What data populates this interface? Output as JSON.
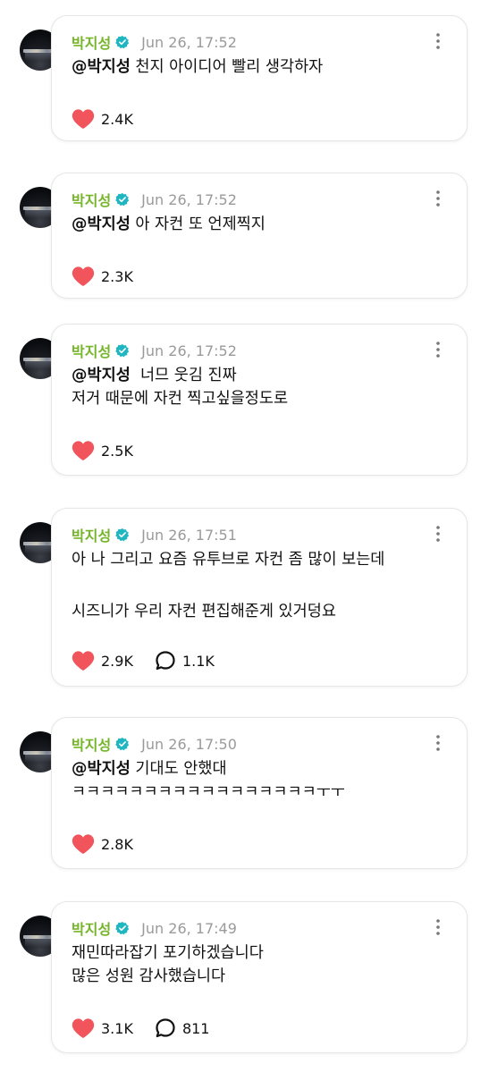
{
  "author": {
    "name": "박지성",
    "verified_icon": "verified-badge-icon",
    "avatar": "night-city-avatar"
  },
  "colors": {
    "name_green": "#76b52b",
    "verified_teal": "#1fb6c1",
    "heart_red": "#f2545b",
    "timestamp_gray": "#9a9a9a"
  },
  "posts": [
    {
      "time": "Jun 26, 17:52",
      "mention": "@박지성",
      "lines": [
        "천지 아이디어 빨리 생각하자"
      ],
      "likes": "2.4K",
      "comments": ""
    },
    {
      "time": "Jun 26, 17:52",
      "mention": "@박지성",
      "lines": [
        "아 자컨 또 언제찍지"
      ],
      "likes": "2.3K",
      "comments": ""
    },
    {
      "time": "Jun 26, 17:52",
      "mention": "@박지성",
      "lines": [
        "너므 웃김 진짜",
        "저거 때문에 자컨 찍고싶을정도로"
      ],
      "likes": "2.5K",
      "comments": ""
    },
    {
      "time": "Jun 26, 17:51",
      "mention": "",
      "lines": [
        "아 나 그리고 요즘 유투브로 자컨 좀 많이 보는데",
        "",
        "시즈니가 우리 자컨 편집해준게 있거덩요"
      ],
      "likes": "2.9K",
      "comments": "1.1K"
    },
    {
      "time": "Jun 26, 17:50",
      "mention": "@박지성",
      "lines": [
        "기대도 안했대",
        "ㅋㅋㅋㅋㅋㅋㅋㅋㅋㅋㅋㅋㅋㅋㅋㅋㅋㅜㅜ"
      ],
      "likes": "2.8K",
      "comments": ""
    },
    {
      "time": "Jun 26, 17:49",
      "mention": "",
      "lines": [
        "재민따라잡기 포기하겠습니다",
        "많은 성원 감사했습니다"
      ],
      "likes": "3.1K",
      "comments": "811"
    }
  ]
}
